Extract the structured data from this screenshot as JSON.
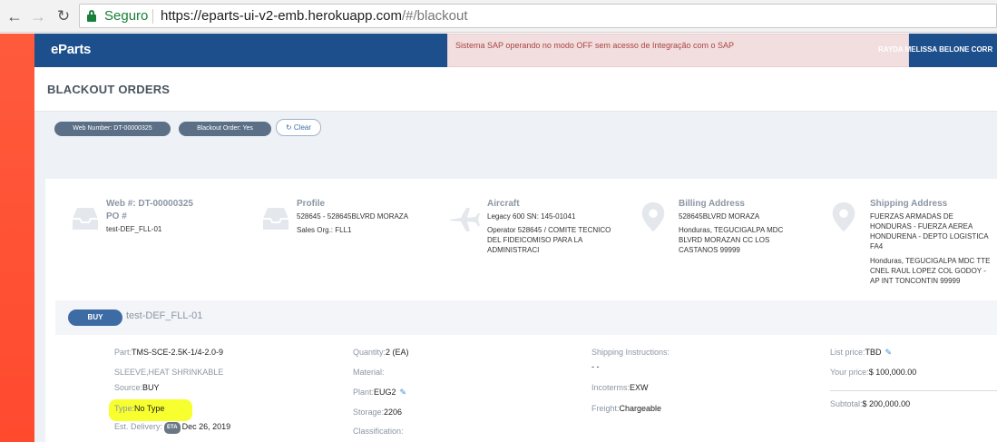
{
  "browser": {
    "secure_label": "Seguro",
    "url_host": "https://eparts-ui-v2-emb.herokuapp.com",
    "url_path": "/#/blackout"
  },
  "header": {
    "logo": "eParts",
    "sap_alert": "Sistema SAP operando no modo OFF sem acesso de Integração com o SAP",
    "user_name": "RAYDA MELISSA BELONE CORR"
  },
  "page": {
    "title": "BLACKOUT ORDERS"
  },
  "filters": {
    "web_number": "Web Number: DT-00000325",
    "blackout_order": "Blackout Order: Yes",
    "clear_label": "Clear"
  },
  "order": {
    "web": {
      "title": "Web #: DT-00000325",
      "po_label": "PO #",
      "po_value": "test-DEF_FLL-01"
    },
    "profile": {
      "title": "Profile",
      "line1": "528645 - 528645BLVRD MORAZA",
      "line2": "Sales Org.: FLL1"
    },
    "aircraft": {
      "title": "Aircraft",
      "line1": "Legacy 600 SN: 145-01041",
      "line2": "Operator 528645 / COMITE TECNICO",
      "line3": "DEL FIDEICOMISO PARA LA",
      "line4": "ADMINISTRACI"
    },
    "billing": {
      "title": "Billing Address",
      "line1": "528645BLVRD MORAZA",
      "line2": "Honduras, TEGUCIGALPA MDC",
      "line3": "BLVRD MORAZAN CC LOS",
      "line4": "CASTANOS 99999"
    },
    "shipping": {
      "title": "Shipping Address",
      "line1": "FUERZAS ARMADAS DE",
      "line2": "HONDURAS - FUERZA AEREA",
      "line3": "HONDURENA - DEPTO LOGISTICA",
      "line4": "FA4",
      "line5": "Honduras, TEGUCIGALPA MDC TTE",
      "line6": "CNEL RAUL LOPEZ COL GODOY -",
      "line7": "AP INT TONCONTIN 99999"
    }
  },
  "item": {
    "buy_label": "BUY",
    "po": "test-DEF_FLL-01",
    "part_label": "Part:",
    "part_value": "TMS-SCE-2.5K-1/4-2.0-9",
    "description": "SLEEVE,HEAT SHRINKABLE",
    "source_label": "Source:",
    "source_value": "BUY",
    "type_label": "Type:",
    "type_value": "No Type",
    "est_delivery_label": "Est. Delivery:",
    "eta_badge": "ETA",
    "est_delivery_value": "Dec 26, 2019",
    "quantity_label": "Quantity:",
    "quantity_value": "2 (EA)",
    "material_label": "Material:",
    "plant_label": "Plant:",
    "plant_value": "EUG2",
    "storage_label": "Storage:",
    "storage_value": "2206",
    "classification_label": "Classification:",
    "shipping_instr_label": "Shipping Instructions:",
    "shipping_instr_value": "- -",
    "incoterms_label": "Incoterms:",
    "incoterms_value": "EXW",
    "freight_label": "Freight:",
    "freight_value": "Chargeable",
    "list_price_label": "List price:",
    "list_price_value": "TBD",
    "your_price_label": "Your price:",
    "your_price_value": "$ 100,000.00",
    "subtotal_label": "Subtotal:",
    "subtotal_value": "$ 200,000.00"
  },
  "colors": {
    "header_blue": "#1c4f8c",
    "alert_bg": "#f2dede",
    "alert_text": "#a94442",
    "highlight_yellow": "#f7ff2e",
    "accent_red": "#ff4a2e"
  }
}
